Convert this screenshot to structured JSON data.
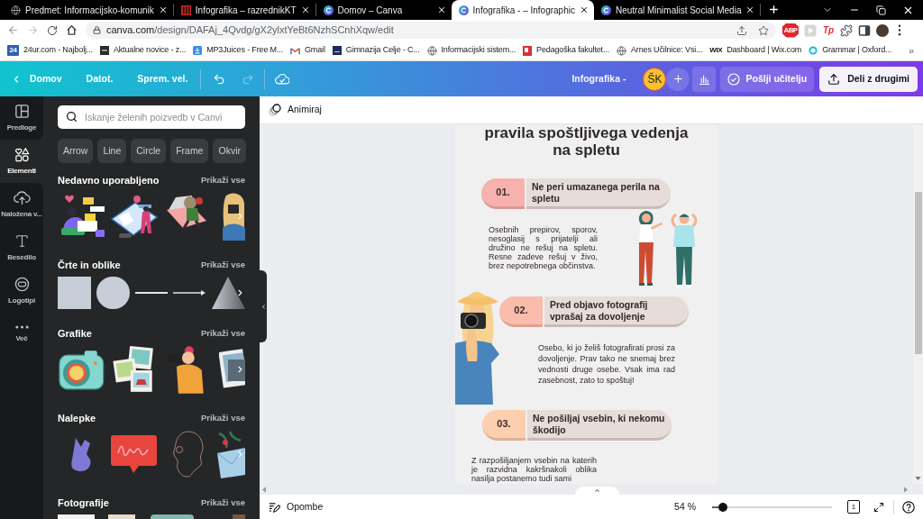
{
  "browser": {
    "tabs": [
      {
        "title": "Predmet: Informacijsko-komunik",
        "kind": "globe",
        "selected": false
      },
      {
        "title": "Infografika – razrednikKT",
        "kind": "slides",
        "selected": false
      },
      {
        "title": "Domov – Canva",
        "kind": "canva",
        "selected": false
      },
      {
        "title": "Infografika - – Infographic",
        "kind": "canva",
        "selected": true
      },
      {
        "title": "Neutral Minimalist Social Media",
        "kind": "canva",
        "selected": false
      }
    ],
    "address": {
      "host": "canva.com",
      "path": "/design/DAFAj_4Qvdg/gX2ylxtYeBt6NzhSCnhXqw/edit"
    },
    "extensions": [
      {
        "kind": "adblock",
        "label": "ABP"
      },
      {
        "kind": "player"
      },
      {
        "kind": "translator",
        "label": "Tp"
      },
      {
        "kind": "puzzle"
      },
      {
        "kind": "sidebar"
      }
    ],
    "bookmarks": [
      {
        "label": "24ur.com - Najbolj...",
        "kind": "news",
        "icon_text": "24"
      },
      {
        "label": "Aktualne novice - z...",
        "kind": "dark"
      },
      {
        "label": "MP3Juices - Free M...",
        "kind": "download"
      },
      {
        "label": "Gmail",
        "kind": "mail"
      },
      {
        "label": "Gimnazija Celje - C...",
        "kind": "school"
      },
      {
        "label": "Informacijski sistem...",
        "kind": "globe"
      },
      {
        "label": "Pedagoška fakultet...",
        "kind": "bookmark"
      },
      {
        "label": "Arnes Učilnice: Vsi...",
        "kind": "globe"
      },
      {
        "label": "Dashboard | Wix.com",
        "kind": "wix",
        "icon_text": "WIX"
      },
      {
        "label": "Grammar | Oxford...",
        "kind": "ring"
      }
    ],
    "bookmarks_more": "»"
  },
  "editor_bar": {
    "home": "Domov",
    "file": "Datot.",
    "resize": "Sprem. vel.",
    "document_title": "Infografika -",
    "avatar": "ŠK",
    "send_button": "Pošlji učitelju",
    "share_button": "Deli z drugimi"
  },
  "sidebar": [
    {
      "label": "Predloge",
      "kind": "templates",
      "selected": false
    },
    {
      "label": "Elementi",
      "kind": "elements",
      "selected": true
    },
    {
      "label": "Naložena v...",
      "kind": "uploads",
      "selected": false
    },
    {
      "label": "Besedilo",
      "kind": "text",
      "selected": false
    },
    {
      "label": "Logotipi",
      "kind": "logos",
      "selected": false
    },
    {
      "label": "Več",
      "kind": "more",
      "selected": false
    }
  ],
  "panel": {
    "search": {
      "placeholder": "Iskanje želenih poizvedb v Canvi"
    },
    "chips": [
      "Arrow",
      "Line",
      "Circle",
      "Frame",
      "Okvir"
    ],
    "sections": [
      {
        "title": "Nedavno uporabljeno",
        "link": "Prikaži vse",
        "kind": "recent"
      },
      {
        "title": "Črte in oblike",
        "link": "Prikaži vse",
        "kind": "shapes"
      },
      {
        "title": "Grafike",
        "link": "Prikaži vse",
        "kind": "graphics"
      },
      {
        "title": "Nalepke",
        "link": "Prikaži vse",
        "kind": "stickers"
      },
      {
        "title": "Fotografije",
        "link": "Prikaži vse",
        "kind": "photos"
      }
    ]
  },
  "canvas": {
    "animate": "Animiraj",
    "title_lines": [
      "pravila spoštljivega vedenja",
      "na spletu"
    ],
    "rules": [
      {
        "number": "01.",
        "heading_lines": [
          "Ne peri umazanega perila na",
          "spletu"
        ],
        "text_lines": [
          "Osebnih prepirov, sporov,",
          "nesoglasij s prijatelji ali",
          "družino ne rešuj na spletu.",
          "Resne zadeve rešuj v živo,",
          "brez nepotrebnega občinstva."
        ],
        "color": "#f7b2ae"
      },
      {
        "number": "02.",
        "heading_lines": [
          "Pred objavo fotografij",
          "vprašaj za dovoljenje"
        ],
        "text_lines": [
          "Osebo, ki jo želiš fotografirati prosi za",
          "dovoljenje. Prav tako ne snemaj brez",
          "vednosti druge osebe. Vsak ima rad",
          "zasebnost, zato to spoštuj!"
        ],
        "color": "#fabcad"
      },
      {
        "number": "03.",
        "heading_lines": [
          "Ne pošiljaj vsebin, ki nekomu",
          "škodijo"
        ],
        "text_lines": [
          "Z razpošiljanjem vsebin na katerih",
          "je razvidna kakršnakoli oblika",
          "nasilja postanemo tudi sami"
        ],
        "color": "#fccfae"
      }
    ]
  },
  "footer": {
    "notes": "Opombe",
    "zoom": "54 %",
    "zoom_slider": {
      "level": 0.09
    },
    "pages": "1"
  }
}
